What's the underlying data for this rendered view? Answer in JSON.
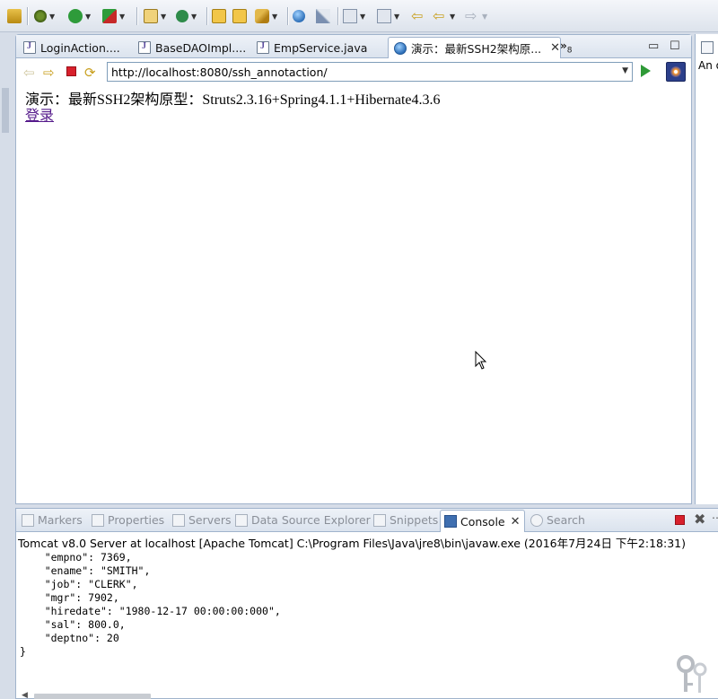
{
  "editor": {
    "tabs": [
      {
        "label": "LoginAction...."
      },
      {
        "label": "BaseDAOImpl...."
      },
      {
        "label": "EmpService.java"
      },
      {
        "label": "演示：最新SSH2架构原..."
      }
    ],
    "overflow_label": "»",
    "overflow_count": "8"
  },
  "browser": {
    "url": "http://localhost:8080/ssh_annotaction/",
    "heading": "演示：最新SSH2架构原型：Struts2.3.16+Spring4.1.1+Hibernate4.3.6",
    "link": "登录"
  },
  "right_panel": {
    "text": "An o"
  },
  "console": {
    "tabs": [
      {
        "label": "Markers"
      },
      {
        "label": "Properties"
      },
      {
        "label": "Servers"
      },
      {
        "label": "Data Source Explorer"
      },
      {
        "label": "Snippets"
      },
      {
        "label": "Console"
      },
      {
        "label": "Search"
      }
    ],
    "process_label": "Tomcat v8.0 Server at localhost [Apache Tomcat] C:\\Program Files\\Java\\jre8\\bin\\javaw.exe (2016年7月24日 下午2:18:31)",
    "output": "    \"empno\": 7369,\n    \"ename\": \"SMITH\",\n    \"job\": \"CLERK\",\n    \"mgr\": 7902,\n    \"hiredate\": \"1980-12-17 00:00:00:000\",\n    \"sal\": 800.0,\n    \"deptno\": 20\n}"
  },
  "colors": {
    "link": "#551a8b",
    "accent": "#3f6fb0",
    "terminate": "#d8202c"
  }
}
